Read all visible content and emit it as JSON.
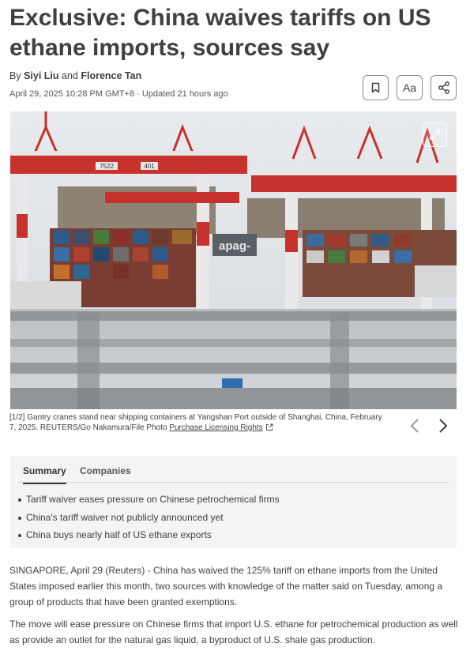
{
  "article": {
    "headline": "Exclusive: China waives tariffs on US ethane imports, sources say",
    "by_prefix": "By",
    "author1": "Siyi Liu",
    "and_word": "and",
    "author2": "Florence Tan",
    "dateline": "April 29, 2025 10:28 PM GMT+8 · Updated 21 hours ago"
  },
  "toolbar": {
    "bookmark_icon": "bookmark-icon",
    "text_size_label": "Aa",
    "share_icon": "share-icon"
  },
  "photo": {
    "signs": [
      "7522",
      "401",
      "apag-",
      "7522",
      "401"
    ],
    "expand_icon": "expand-icon"
  },
  "caption": {
    "text": "[1/2] Gantry cranes stand near shipping containers at Yangshan Port outside of Shanghai, China, February 7, 2025. REUTERS/Go Nakamura/File Photo ",
    "link": "Purchase Licensing Rights"
  },
  "gallery": {
    "prev_icon": "chevron-left-icon",
    "next_icon": "chevron-right-icon"
  },
  "summary": {
    "tabs": [
      "Summary",
      "Companies"
    ],
    "active_tab": "Summary",
    "bullets": [
      "Tariff waiver eases pressure on Chinese petrochemical firms",
      "China's tariff waiver not publicly announced yet",
      "China buys nearly half of US ethane exports"
    ]
  },
  "body": {
    "paragraphs": [
      "SINGAPORE, April 29 (Reuters) - China has waived the 125% tariff on ethane imports from the United States imposed earlier this month, two sources with knowledge of the matter said on Tuesday, among a group of products that have been granted exemptions.",
      "The move will ease pressure on Chinese firms that import U.S. ethane for petrochemical production as well as provide an outlet for the natural gas liquid, a byproduct of U.S. shale gas production."
    ]
  },
  "colors": {
    "text": "#404040",
    "crane_red": "#c8322c",
    "panel": "#f4f4f4"
  }
}
